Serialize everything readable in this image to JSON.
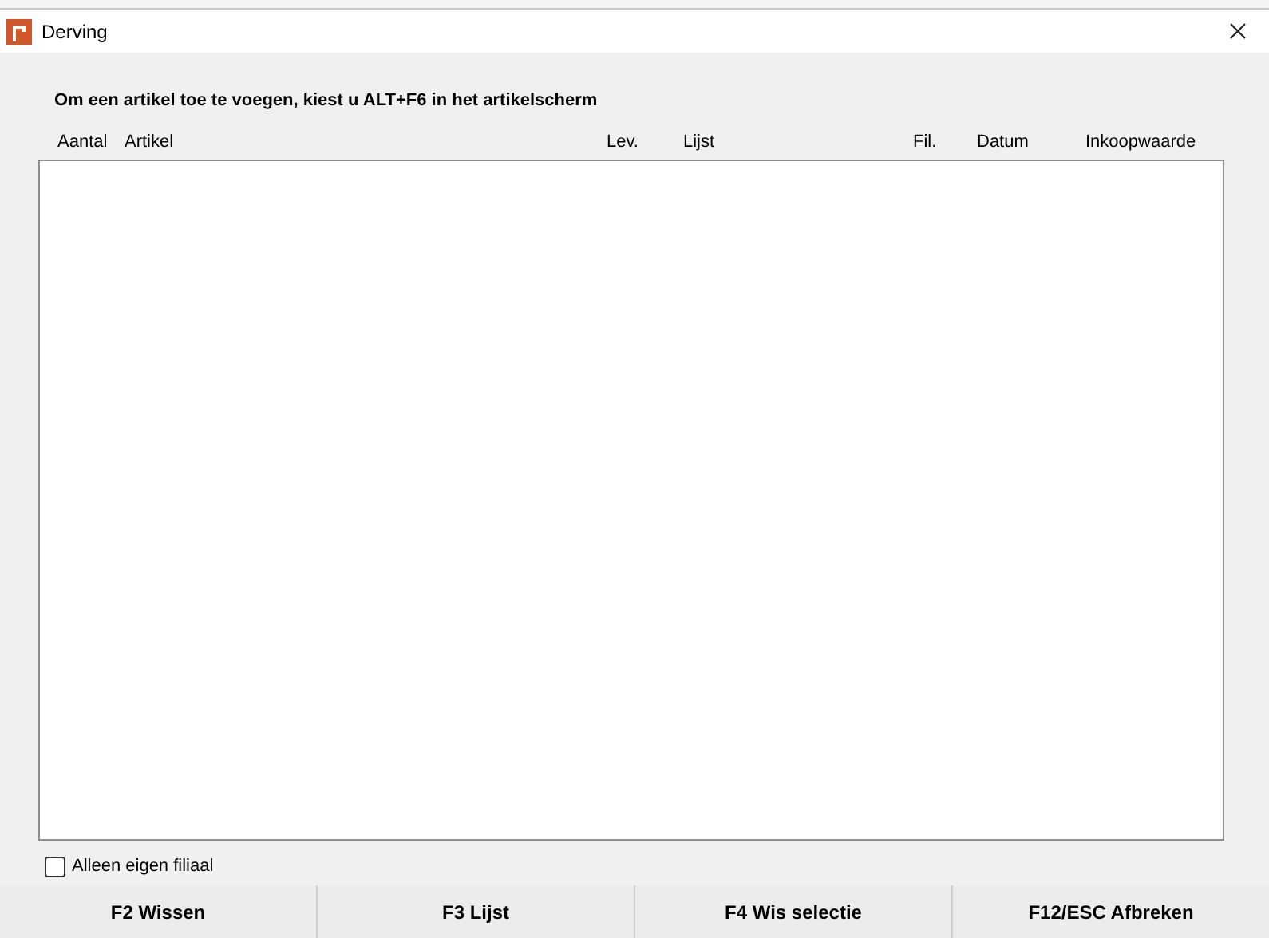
{
  "window": {
    "title": "Derving"
  },
  "instruction": "Om een artikel toe te voegen, kiest u ALT+F6 in het artikelscherm",
  "table": {
    "columns": [
      "Aantal",
      "Artikel",
      "Lev.",
      "Lijst",
      "Fil.",
      "Datum",
      "Inkoopwaarde"
    ]
  },
  "filter": {
    "label": "Alleen eigen filiaal",
    "checked": false
  },
  "buttons": [
    "F2 Wissen",
    "F3 Lijst",
    "F4 Wis selectie",
    "F12/ESC Afbreken"
  ]
}
